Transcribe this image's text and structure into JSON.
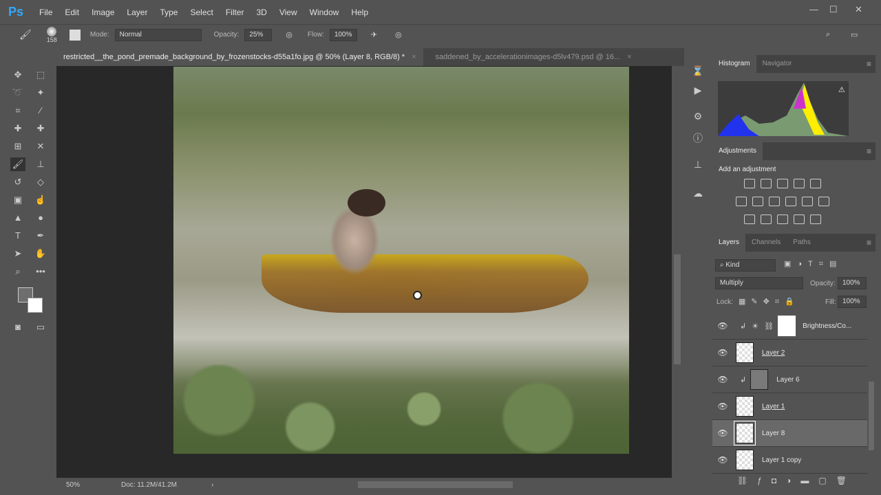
{
  "app": {
    "logo": "Ps",
    "menus": [
      "File",
      "Edit",
      "Image",
      "Layer",
      "Type",
      "Select",
      "Filter",
      "3D",
      "View",
      "Window",
      "Help"
    ]
  },
  "options": {
    "brush_size": "158",
    "mode_label": "Mode:",
    "mode": "Normal",
    "opacity_label": "Opacity:",
    "opacity": "25%",
    "flow_label": "Flow:",
    "flow": "100%"
  },
  "tabs": [
    {
      "label": "restricted__the_pond_premade_background_by_frozenstocks-d55a1fo.jpg @ 50% (Layer 8, RGB/8) *",
      "close": "×"
    },
    {
      "label": "saddened_by_accelerationimages-d5lv479.psd @ 16...",
      "close": "×"
    }
  ],
  "status": {
    "zoom": "50%",
    "doc": "Doc: 11.2M/41.2M"
  },
  "panels": {
    "histogram_tabs": [
      "Histogram",
      "Navigator"
    ],
    "adjustments": {
      "title": "Adjustments",
      "subtitle": "Add an adjustment"
    },
    "layers_tabs": [
      "Layers",
      "Channels",
      "Paths"
    ],
    "filter": "Kind",
    "blend_mode": "Multiply",
    "opacity_label": "Opacity:",
    "opacity": "100%",
    "lock_label": "Lock:",
    "fill_label": "Fill:",
    "fill": "100%",
    "layers": [
      {
        "name": "Brightness/Co..."
      },
      {
        "name": "Layer 2"
      },
      {
        "name": "Layer 6"
      },
      {
        "name": "Layer 1"
      },
      {
        "name": "Layer 8"
      },
      {
        "name": "Layer 1 copy"
      }
    ]
  }
}
